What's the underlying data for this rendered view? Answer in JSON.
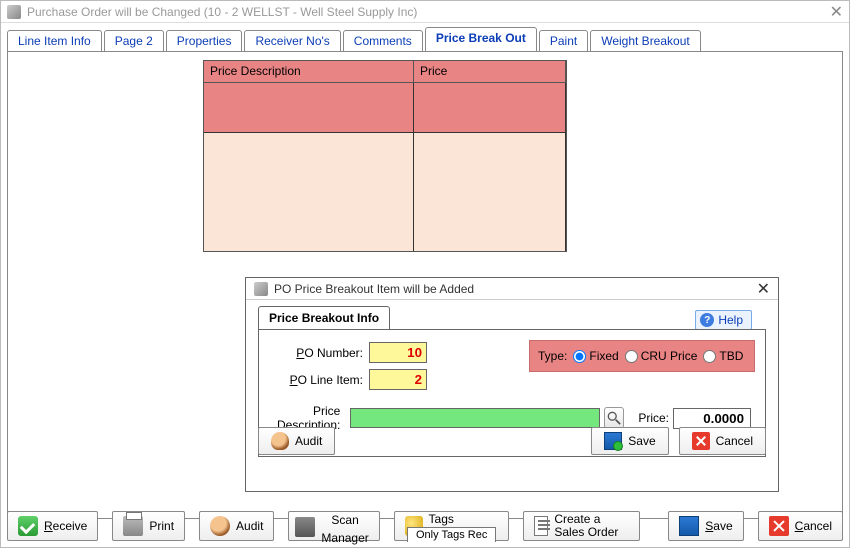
{
  "window": {
    "title": "Purchase Order will be Changed  (10 - 2  WELLST - Well Steel Supply Inc)"
  },
  "tabs": [
    "Line Item Info",
    "Page 2",
    "Properties",
    "Receiver No's",
    "Comments",
    "Price Break Out",
    "Paint",
    "Weight Breakout"
  ],
  "active_tab": "Price Break Out",
  "grid": {
    "headers": [
      "Price Description",
      "Price"
    ]
  },
  "dialog": {
    "title": "PO Price Breakout Item will be Added",
    "subtab": "Price Breakout Info",
    "help_label": "Help",
    "fields": {
      "po_number_label": "PO Number:",
      "po_number_value": "10",
      "po_line_label": "PO Line Item:",
      "po_line_value": "2",
      "type_label": "Type:",
      "type_options": {
        "fixed": "Fixed",
        "cru": "CRU Price",
        "tbd": "TBD"
      },
      "type_selected": "fixed",
      "desc_label": "Price Description:",
      "desc_value": "",
      "price_label": "Price:",
      "price_value": "0.0000"
    },
    "buttons": {
      "audit": "Audit",
      "save": "Save",
      "cancel": "Cancel"
    }
  },
  "bottombar": {
    "receive": "Receive",
    "print": "Print",
    "audit": "Audit",
    "scan": "Scan Manager",
    "tags": "Tags Received",
    "sales": "Create a Sales Order",
    "only_tags": "Only Tags Rec",
    "save": "Save",
    "cancel": "Cancel"
  }
}
